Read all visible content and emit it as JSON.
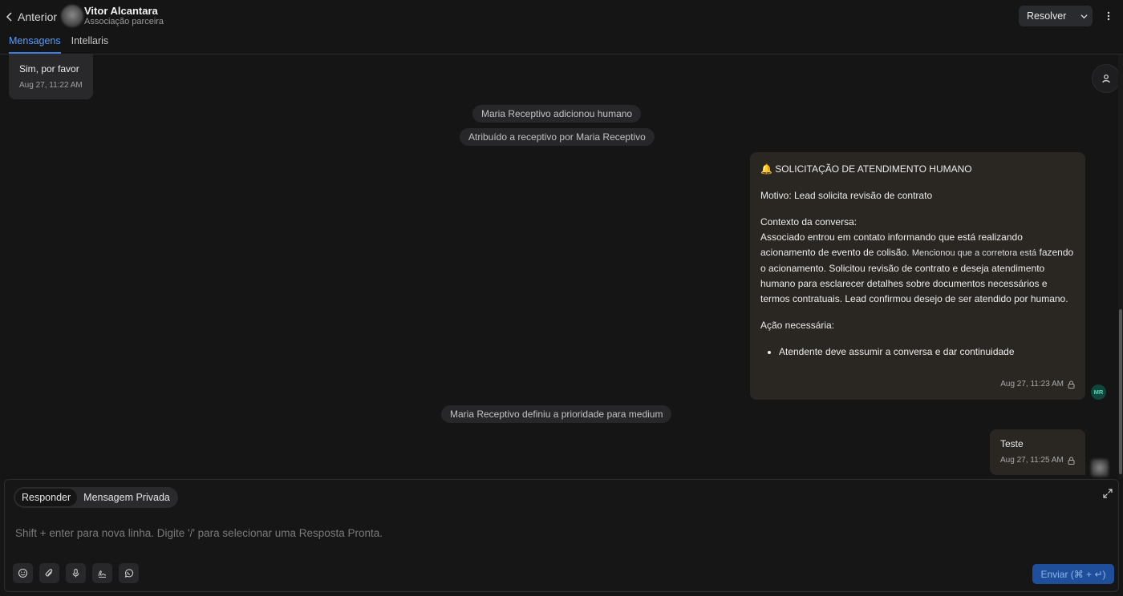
{
  "header": {
    "back_label": "Anterior",
    "contact_name": "Vitor Alcantara",
    "contact_subtitle": "Associação parceira",
    "tabs": [
      {
        "label": "Mensagens",
        "active": true
      },
      {
        "label": "Intellaris",
        "active": false
      }
    ],
    "resolve_label": "Resolver"
  },
  "messages": {
    "incoming": {
      "text": "Sim, por favor",
      "time": "Aug 27, 11:22 AM"
    },
    "events": [
      "Maria Receptivo adicionou humano",
      "Atribuído a receptivo por Maria Receptivo",
      "Maria Receptivo definiu a prioridade para medium"
    ],
    "handoff": {
      "title": "🔔 SOLICITAÇÃO DE ATENDIMENTO HUMANO",
      "reason": "Motivo: Lead solicita revisão de contrato",
      "context_title": "Contexto da conversa:",
      "context_part1": "Associado entrou em contato informando que está realizando acionamento de evento de colisão.",
      "context_part2": "Mencionou que a corretora está",
      "context_part3": "fazendo o acionamento. Solicitou revisão de contrato e deseja atendimento humano para esclarecer detalhes sobre documentos necessários e termos contratuais. Lead confirmou desejo de ser atendido por humano.",
      "action_title": "Ação necessária:",
      "action_items": [
        "Atendente deve assumir a conversa e dar continuidade"
      ],
      "time": "Aug 27, 11:23 AM",
      "avatar_initials": "MR"
    },
    "outgoing": {
      "text": "Teste",
      "time": "Aug 27, 11:25 AM"
    }
  },
  "composer": {
    "modes": [
      {
        "label": "Responder",
        "active": true
      },
      {
        "label": "Mensagem Privada",
        "active": false
      }
    ],
    "placeholder": "Shift + enter para nova linha. Digite '/' para selecionar uma Resposta Pronta.",
    "tools": [
      "emoji-icon",
      "paperclip-icon",
      "microphone-icon",
      "signature-icon",
      "whatsapp-icon"
    ],
    "send_label": "Enviar (⌘ + ↵)"
  },
  "colors": {
    "accent": "#3d7fe6",
    "outgoing_bubble": "#2a2722",
    "incoming_bubble": "#29292c",
    "send_button": "#1f4f9a"
  }
}
